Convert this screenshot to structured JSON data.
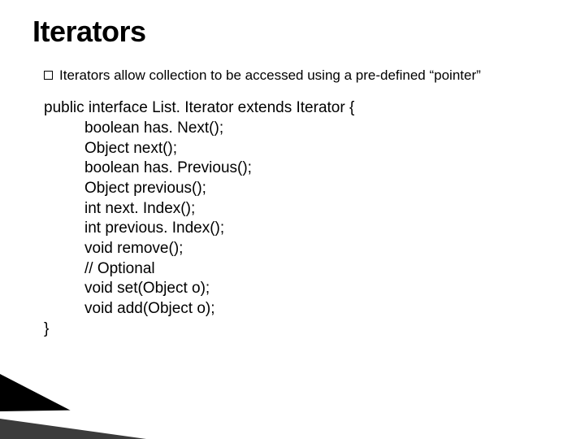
{
  "title": "Iterators",
  "bullet": {
    "text": "Iterators allow collection to be accessed using a pre-defined “pointer”"
  },
  "code": {
    "line1": "public interface List. Iterator extends Iterator {",
    "line2": "boolean has. Next();",
    "line3": "Object next();",
    "line4": "boolean has. Previous();",
    "line5": "Object previous();",
    "line6": "int next. Index();",
    "line7": "int previous. Index();",
    "line8": "void remove();",
    "line9": "// Optional",
    "line10": "void set(Object o);",
    "line11": "void add(Object o);",
    "line12": "}"
  }
}
